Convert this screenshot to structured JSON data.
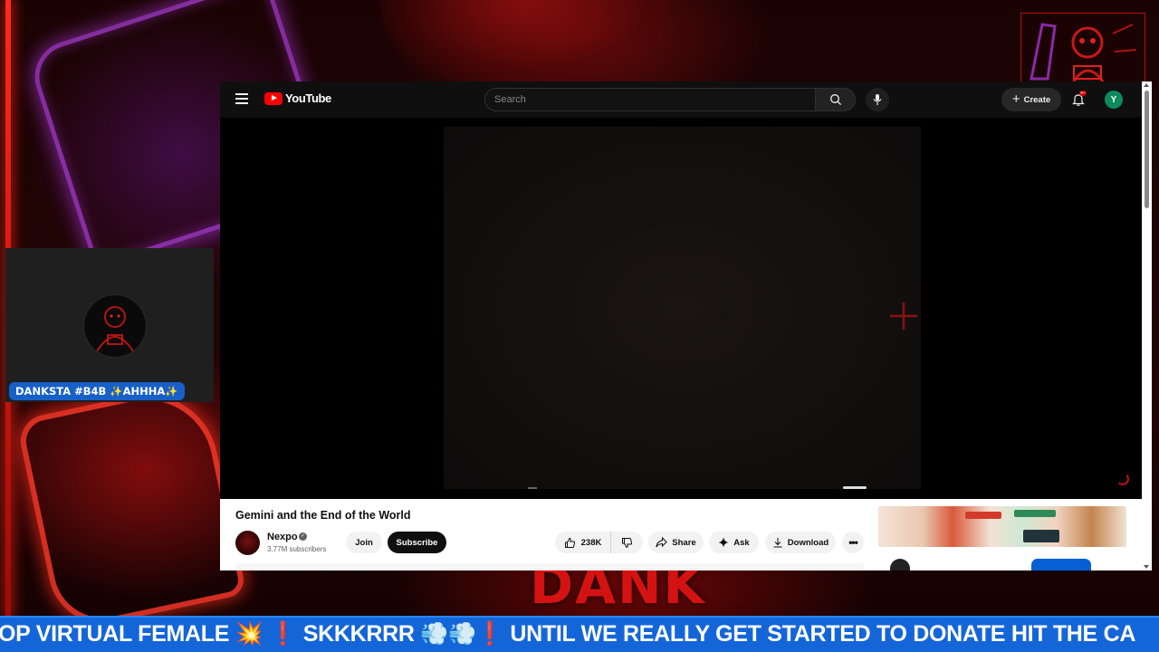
{
  "overlay": {
    "background_word": "DANK",
    "webcam_name": "DANKSTA #B4B ✨AHHHA✨",
    "ticker": "OP VIRTUAL FEMALE 💥 ❗ SKKKRRR 💨💨❗ UNTIL WE REALLY GET STARTED TO DONATE HIT THE CA",
    "colors": {
      "accent_red": "#d41212",
      "ticker_blue": "#1466d8",
      "neon_purple": "#b040e0"
    }
  },
  "youtube": {
    "logo_text": "YouTube",
    "search": {
      "placeholder": "Search"
    },
    "create_label": "Create",
    "notification_badge": "9+",
    "account_initial": "Y",
    "video": {
      "title": "Gemini and the End of the World",
      "channel": "Nexpo",
      "subscribers": "3.77M subscribers",
      "join_label": "Join",
      "subscribe_label": "Subscribe",
      "likes": "238K",
      "share_label": "Share",
      "ask_label": "Ask",
      "download_label": "Download",
      "more_label": "•••"
    },
    "icons": [
      "menu-icon",
      "youtube-logo-icon",
      "search-icon",
      "mic-icon",
      "plus-icon",
      "bell-icon",
      "like-icon",
      "dislike-icon",
      "share-icon",
      "sparkle-icon",
      "download-icon",
      "more-icon",
      "crosshair-icon"
    ]
  }
}
